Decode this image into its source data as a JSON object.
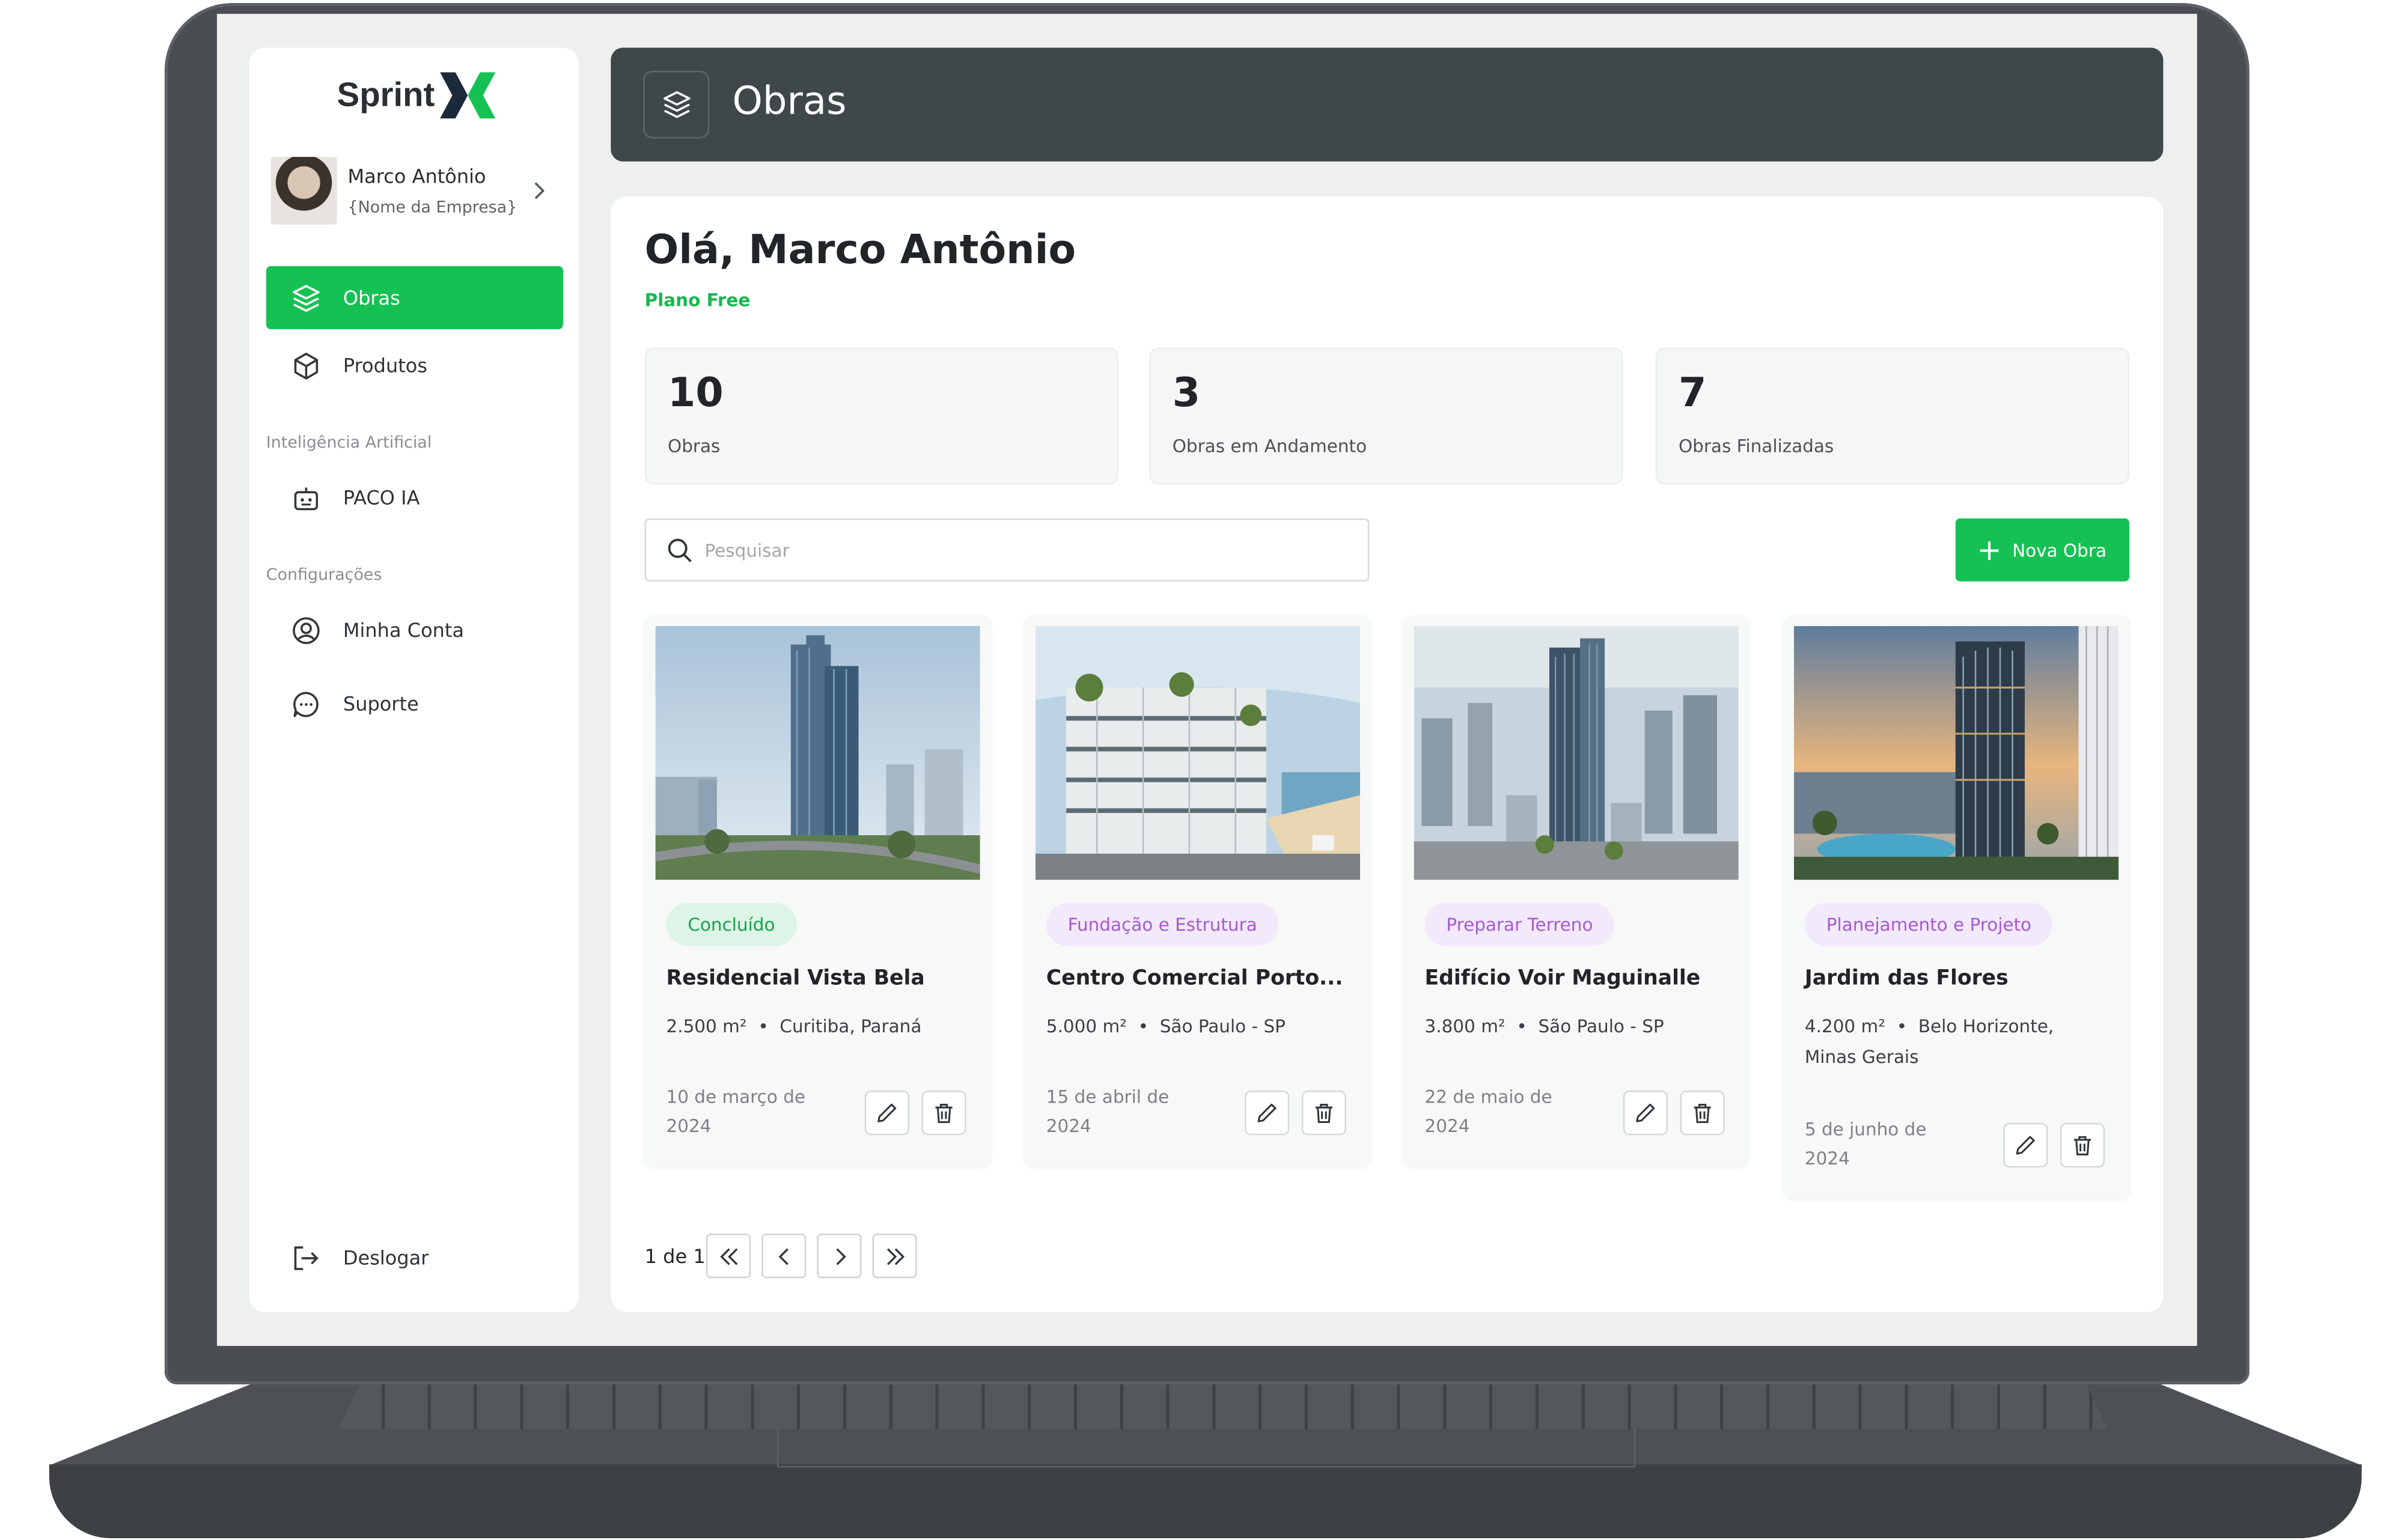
{
  "app": {
    "brand": "Sprint",
    "brand_color": "#16c154"
  },
  "user": {
    "name": "Marco Antônio",
    "company": "{Nome da Empresa}"
  },
  "sidebar": {
    "items": [
      {
        "label": "Obras",
        "icon": "layers-icon",
        "active": true
      },
      {
        "label": "Produtos",
        "icon": "box-icon",
        "active": false
      }
    ],
    "section_ai": "Inteligência Artificial",
    "ai_item": {
      "label": "PACO IA",
      "icon": "robot-icon"
    },
    "section_config": "Configurações",
    "config_items": [
      {
        "label": "Minha Conta",
        "icon": "user-circle-icon"
      },
      {
        "label": "Suporte",
        "icon": "chat-icon"
      }
    ],
    "logout": {
      "label": "Deslogar",
      "icon": "logout-icon"
    }
  },
  "header": {
    "title": "Obras",
    "icon": "layers-icon"
  },
  "main": {
    "greeting": "Olá, Marco Antônio",
    "plan": "Plano Free",
    "stats": [
      {
        "value": "10",
        "label": "Obras"
      },
      {
        "value": "3",
        "label": "Obras em Andamento"
      },
      {
        "value": "7",
        "label": "Obras Finalizadas"
      }
    ],
    "search": {
      "placeholder": "Pesquisar"
    },
    "new_button": "Nova Obra",
    "projects": [
      {
        "status": "Concluído",
        "name": "Residencial Vista Bela",
        "area": "2.500 m²",
        "location": "Curitiba, Paraná",
        "date": "10 de março de 2024"
      },
      {
        "status": "Fundação e Estrutura",
        "name": "Centro Comercial Porto...",
        "area": "5.000 m²",
        "location": "São Paulo - SP",
        "date": "15 de abril de 2024"
      },
      {
        "status": "Preparar Terreno",
        "name": "Edifício Voir Maguinalle",
        "area": "3.800 m²",
        "location": "São Paulo - SP",
        "date": "22 de maio de 2024"
      },
      {
        "status": "Planejamento e Projeto",
        "name": "Jardim das Flores",
        "area": "4.200 m²",
        "location": "Belo Horizonte, Minas Gerais",
        "date": "5 de junho de 2024"
      }
    ],
    "pagination": {
      "text": "1 de 1"
    }
  },
  "colors": {
    "accent": "#16c154",
    "header_bg": "#3f4749",
    "done_badge_bg": "#dcf5e6",
    "phase_badge_bg": "#f2e9fb"
  }
}
